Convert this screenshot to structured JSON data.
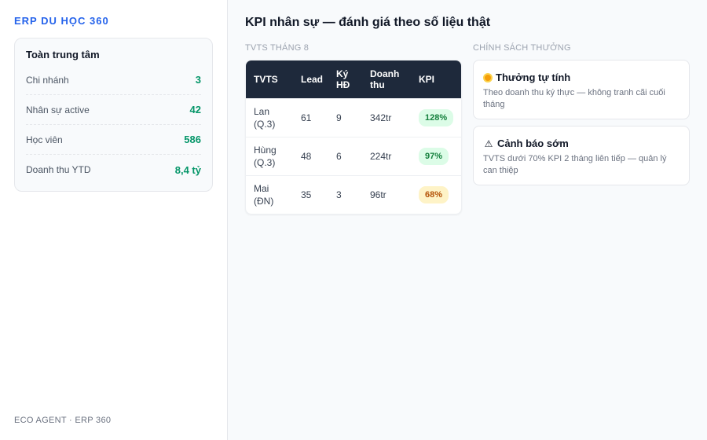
{
  "sidebar": {
    "brand": "ERP DU HỌC 360",
    "card_title": "Toàn trung tâm",
    "stats": [
      {
        "label": "Chi nhánh",
        "value": "3"
      },
      {
        "label": "Nhân sự active",
        "value": "42"
      },
      {
        "label": "Học viên",
        "value": "586"
      },
      {
        "label": "Doanh thu YTD",
        "value": "8,4 tỷ"
      }
    ],
    "footer": "ECO AGENT · ERP 360"
  },
  "main": {
    "title": "KPI nhân sự — đánh giá theo số liệu thật",
    "table_section": "TVTS THÁNG 8",
    "policy_section": "CHÍNH SÁCH THƯỞNG",
    "table": {
      "headers": [
        "TVTS",
        "Lead",
        "Ký HĐ",
        "Doanh thu",
        "KPI"
      ],
      "rows": [
        {
          "name": "Lan (Q.3)",
          "lead": "61",
          "signed": "9",
          "revenue": "342tr",
          "kpi": "128%",
          "status": "green"
        },
        {
          "name": "Hùng (Q.3)",
          "lead": "48",
          "signed": "6",
          "revenue": "224tr",
          "kpi": "97%",
          "status": "green"
        },
        {
          "name": "Mai (ĐN)",
          "lead": "35",
          "signed": "3",
          "revenue": "96tr",
          "kpi": "68%",
          "status": "amber"
        }
      ]
    },
    "policies": [
      {
        "icon": "medal-icon",
        "title": "Thưởng tự tính",
        "desc": "Theo doanh thu ký thực — không tranh cãi cuối tháng"
      },
      {
        "icon": "warning-icon",
        "title": "Cảnh báo sớm",
        "desc": "TVTS dưới 70% KPI 2 tháng liên tiếp — quản lý can thiệp"
      }
    ]
  },
  "colors": {
    "brand": "#2563eb",
    "stat_value": "#059669",
    "table_header": "#1e293b",
    "kpi_good": "#15803d",
    "kpi_warn": "#b45309"
  }
}
